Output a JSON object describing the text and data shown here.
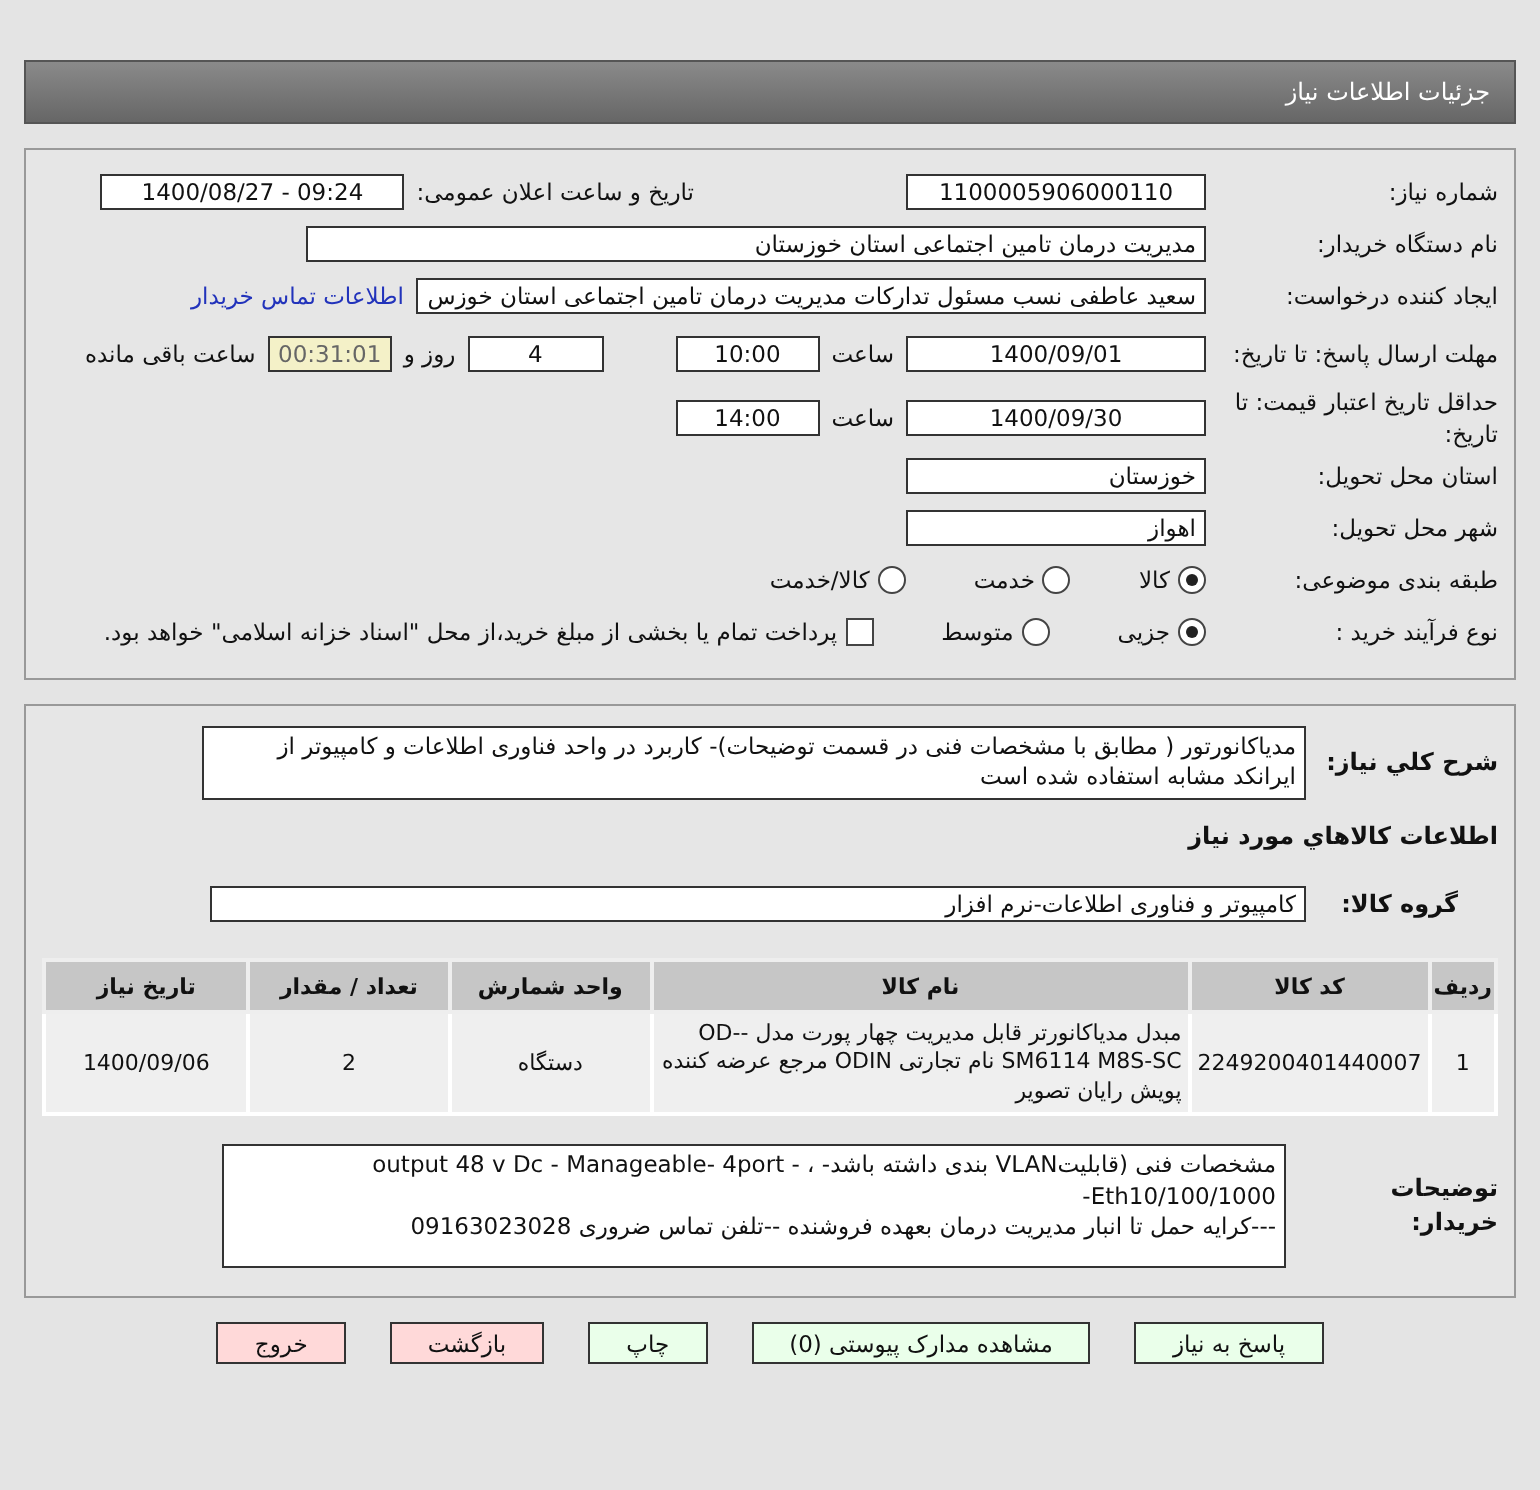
{
  "header": {
    "title": "جزئیات اطلاعات نیاز"
  },
  "need_number": {
    "label": "شماره نیاز:",
    "value": "1100005906000110"
  },
  "announce": {
    "label": "تاریخ و ساعت اعلان عمومی:",
    "value": "1400/08/27 - 09:24"
  },
  "buyer_org": {
    "label": "نام دستگاه خریدار:",
    "value": "مدیریت درمان تامین اجتماعی استان خوزستان"
  },
  "creator": {
    "label": "ایجاد کننده درخواست:",
    "value": "سعید عاطفی نسب مسئول تداركات مدیریت درمان تامین اجتماعی استان خوزس",
    "link": "اطلاعات تماس خریدار"
  },
  "deadline": {
    "label": "مهلت ارسال پاسخ: تا تاریخ:",
    "date": "1400/09/01",
    "time_label": "ساعت",
    "time": "10:00",
    "days": "4",
    "days_label": "روز و",
    "remaining": "00:31:01",
    "remaining_label": "ساعت باقی مانده"
  },
  "validity": {
    "label": "حداقل تاریخ اعتبار قیمت: تا تاریخ:",
    "date": "1400/09/30",
    "time_label": "ساعت",
    "time": "14:00"
  },
  "province": {
    "label": "استان محل تحویل:",
    "value": "خوزستان"
  },
  "city": {
    "label": "شهر محل تحویل:",
    "value": "اهواز"
  },
  "category": {
    "label": "طبقه بندی موضوعی:",
    "options": [
      {
        "label": "کالا",
        "selected": true
      },
      {
        "label": "خدمت",
        "selected": false
      },
      {
        "label": "کالا/خدمت",
        "selected": false
      }
    ]
  },
  "process": {
    "label": "نوع فرآیند خرید :",
    "options": [
      {
        "label": "جزیی",
        "selected": true
      },
      {
        "label": "متوسط",
        "selected": false
      }
    ],
    "checkbox": {
      "label": "پرداخت تمام یا بخشی از مبلغ خرید،از محل \"اسناد خزانه اسلامی\" خواهد بود.",
      "checked": false
    }
  },
  "description": {
    "label": "شرح كلي نياز:",
    "text": "مدیاکانورتور ( مطابق با مشخصات فنی در قسمت توضیحات)- کاربرد در واحد فناوری اطلاعات و کامپیوتر از ایرانکد مشابه استفاده شده است"
  },
  "goods_title": "اطلاعات كالاهاي مورد نياز",
  "goods_group": {
    "label": "گروه كالا:",
    "value": "کامپیوتر و فناوری اطلاعات-نرم افزار"
  },
  "table": {
    "columns": [
      "ردیف",
      "کد کالا",
      "نام کالا",
      "واحد شمارش",
      "تعداد / مقدار",
      "تاریخ نیاز"
    ],
    "rows": [
      [
        "1",
        "2249200401440007",
        "مبدل مدیاکانورتر قابل مدیریت چهار پورت مدل -OD-SM6114 M8S-SC نام تجارتی ODIN مرجع عرضه کننده پویش رایان تصویر",
        "دستگاه",
        "2",
        "1400/09/06"
      ]
    ]
  },
  "buyer_notes": {
    "label": "توضیحات خریدار:",
    "lines": [
      "مشخصات فنی (قابلیتVLAN  بندی داشته باشد- ، output 48 v Dc - Manageable- 4port -Eth10/100/1000-",
      "---کرایه حمل تا انبار مدیریت درمان بعهده فروشنده --تلفن تماس ضروری 09163023028"
    ]
  },
  "buttons": [
    {
      "label": "پاسخ به نیاز",
      "kind": "primary"
    },
    {
      "label": "مشاهده مدارک پیوستی (0)",
      "kind": "primary"
    },
    {
      "label": "چاپ",
      "kind": "primary"
    },
    {
      "label": "بازگشت",
      "kind": "danger"
    },
    {
      "label": "خروج",
      "kind": "danger"
    }
  ]
}
